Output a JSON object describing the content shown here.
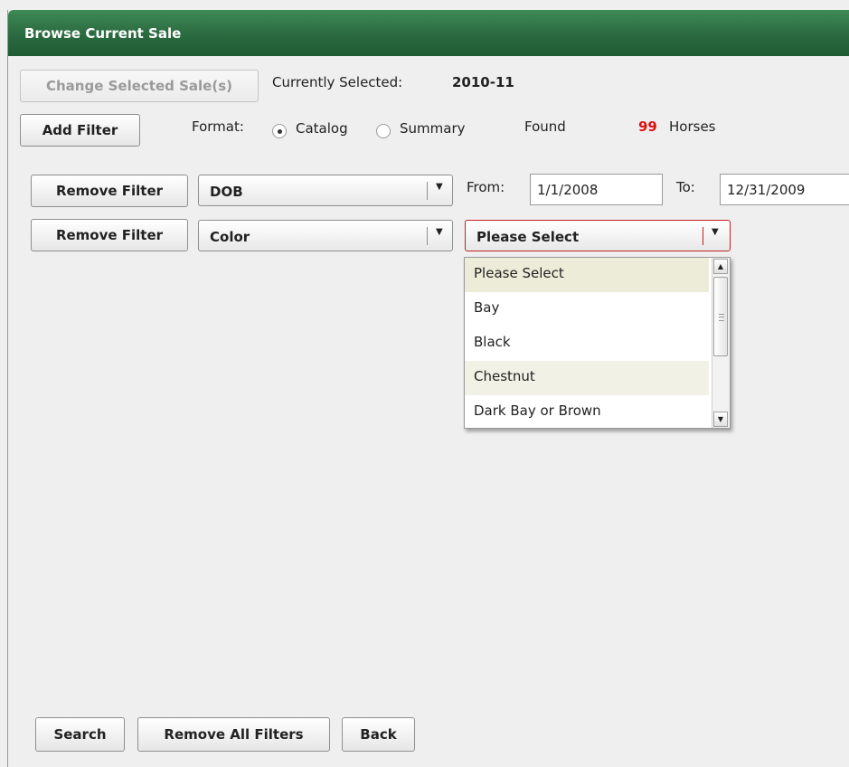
{
  "header": {
    "title": "Browse Current Sale"
  },
  "top": {
    "change_sale_label": "Change Selected Sale(s)",
    "currently_selected_label": "Currently Selected:",
    "currently_selected_value": "2010-11",
    "add_filter_label": "Add Filter",
    "format_label": "Format:",
    "format_options": [
      {
        "label": "Catalog",
        "selected": true
      },
      {
        "label": "Summary",
        "selected": false
      }
    ],
    "found_label": "Found",
    "found_count": "99",
    "found_unit": "Horses"
  },
  "filters": [
    {
      "remove_label": "Remove Filter",
      "field": "DOB",
      "from_label": "From:",
      "from_value": "1/1/2008",
      "to_label": "To:",
      "to_value": "12/31/2009"
    },
    {
      "remove_label": "Remove Filter",
      "field": "Color",
      "value_select": "Please Select"
    }
  ],
  "color_dropdown": {
    "options": [
      "Please Select",
      "Bay",
      "Black",
      "Chestnut",
      "Dark Bay or Brown"
    ]
  },
  "bottom": {
    "search_label": "Search",
    "remove_all_label": "Remove All Filters",
    "back_label": "Back"
  },
  "colors": {
    "header_green": "#2a6a3f",
    "count_red": "#e01010",
    "active_border": "#c02020"
  }
}
